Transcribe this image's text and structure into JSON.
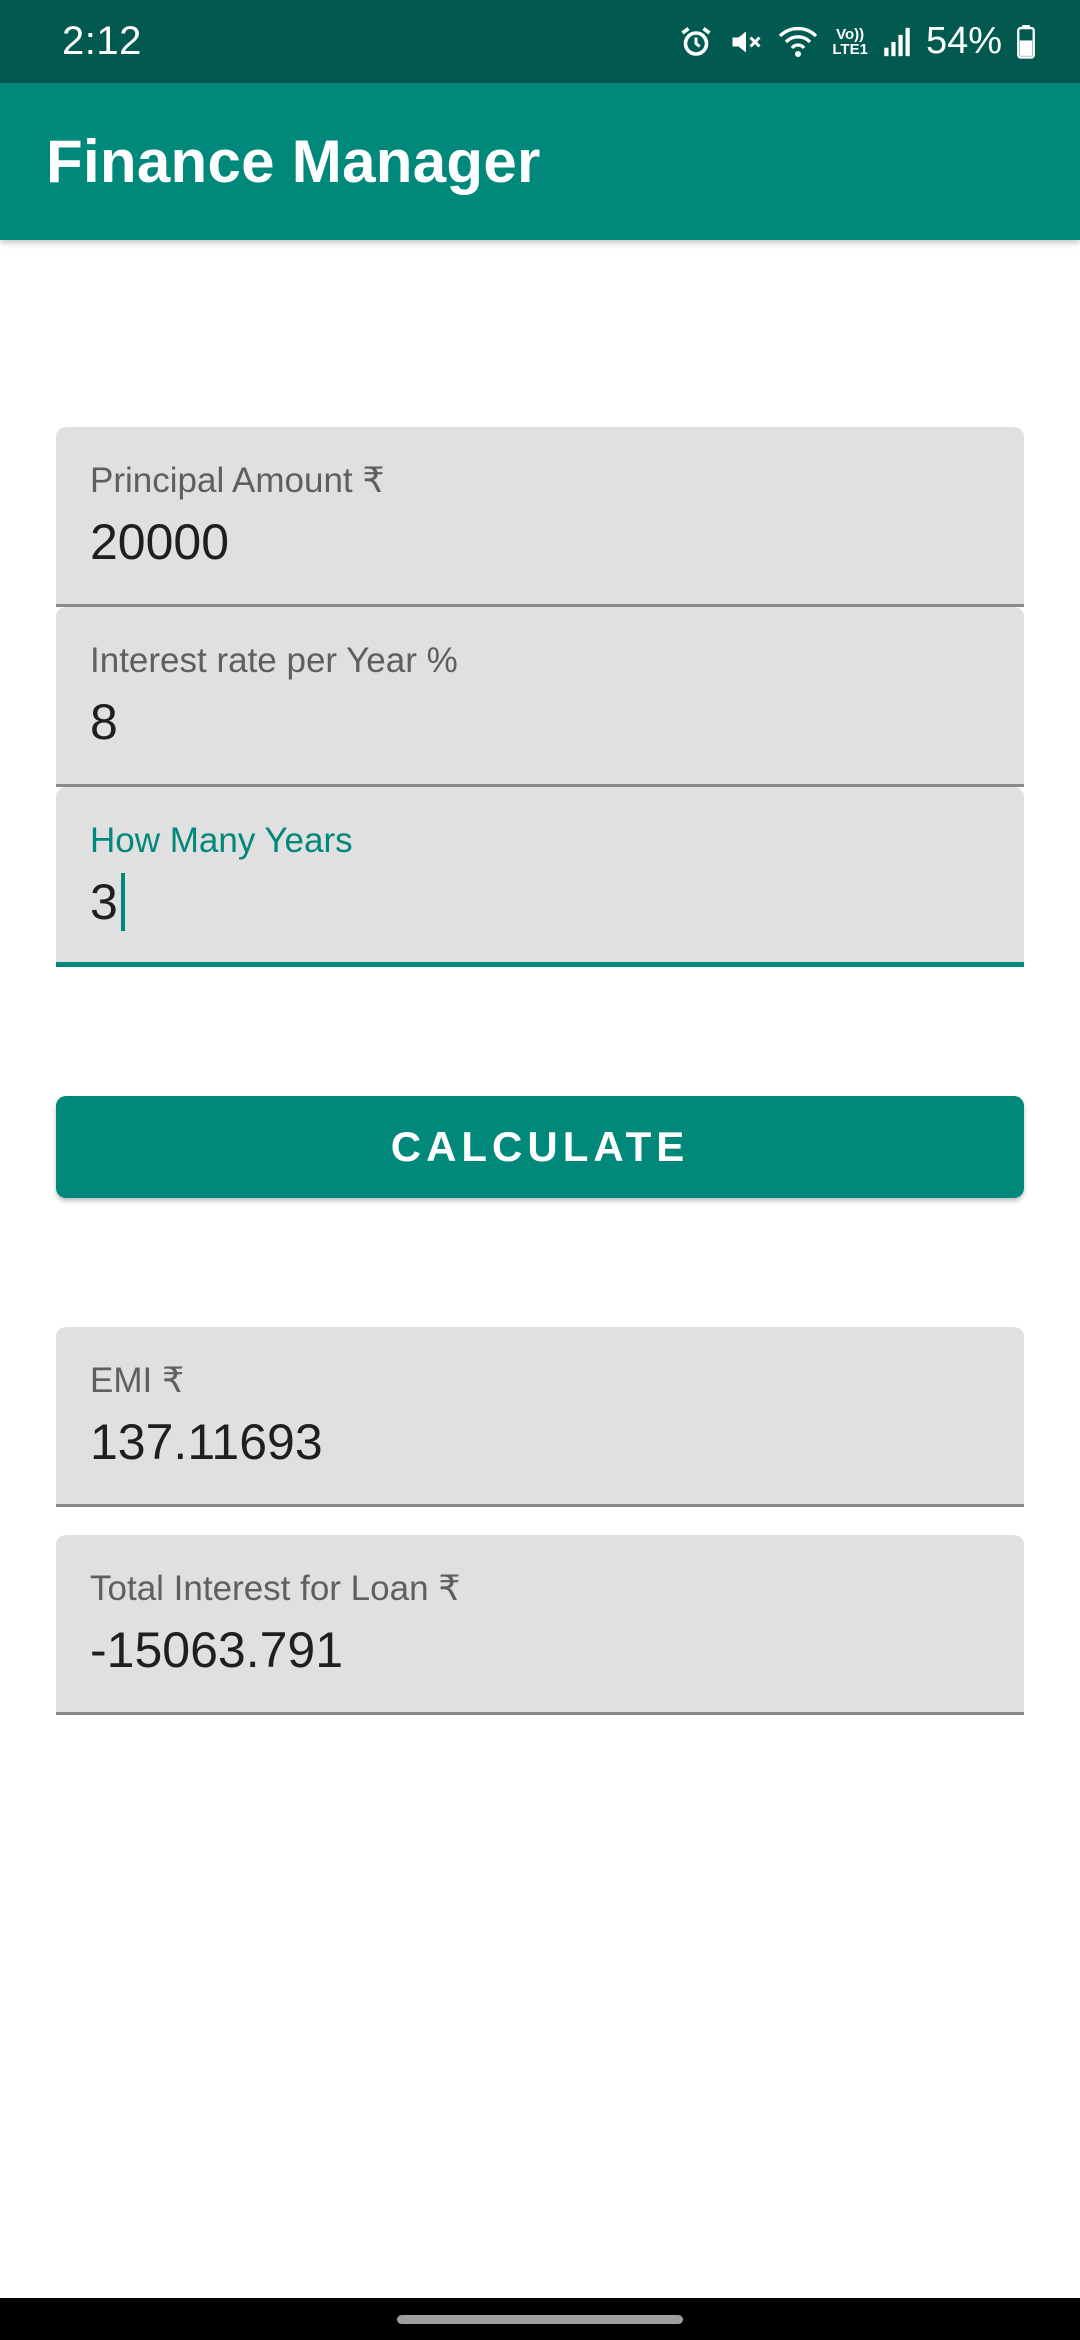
{
  "status_bar": {
    "time": "2:12",
    "lte_top": "Vo))",
    "lte_bottom": "LTE1",
    "battery_percent": "54%",
    "icons": [
      "alarm-icon",
      "mute-icon",
      "wifi-icon",
      "lte-icon",
      "signal-icon",
      "battery-icon"
    ]
  },
  "app_bar": {
    "title": "Finance Manager"
  },
  "form": {
    "principal": {
      "label": "Principal Amount ₹",
      "value": "20000"
    },
    "interest_rate": {
      "label": "Interest rate per Year %",
      "value": "8"
    },
    "years": {
      "label": "How Many Years",
      "value": "3"
    }
  },
  "calculate_label": "CALCULATE",
  "results": {
    "emi": {
      "label": "EMI ₹",
      "value": "137.11693"
    },
    "total_interest": {
      "label": "Total Interest for Loan ₹",
      "value": "-15063.791"
    }
  },
  "colors": {
    "primary": "#00897b",
    "primary_dark": "#01594f",
    "field_bg": "#e0e0e0"
  }
}
